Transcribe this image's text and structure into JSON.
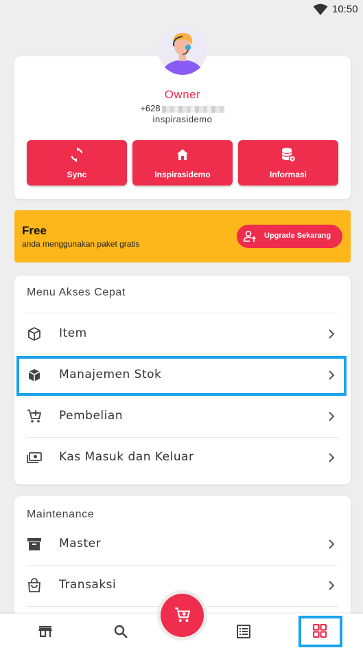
{
  "status_bar": {
    "time": "10:50"
  },
  "profile": {
    "name": "Owner",
    "phone_prefix": "+628",
    "store": "inspirasidemo",
    "actions": [
      {
        "label": "Sync",
        "icon": "sync-icon"
      },
      {
        "label": "Inspirasidemo",
        "icon": "store-icon"
      },
      {
        "label": "Informasi",
        "icon": "database-gear-icon"
      }
    ]
  },
  "plan": {
    "title": "Free",
    "subtitle": "anda menggunakan paket gratis",
    "upgrade_label": "Upgrade Sekarang"
  },
  "quick_menu": {
    "title": "Menu Akses Cepat",
    "items": [
      {
        "label": "Item",
        "icon": "box-icon"
      },
      {
        "label": "Manajemen Stok",
        "icon": "box-settings-icon"
      },
      {
        "label": "Pembelian",
        "icon": "cart-plus-icon"
      },
      {
        "label": "Kas Masuk dan Keluar",
        "icon": "cash-icon"
      }
    ]
  },
  "maintenance": {
    "title": "Maintenance",
    "items": [
      {
        "label": "Master",
        "icon": "archive-icon"
      },
      {
        "label": "Transaksi",
        "icon": "shopping-bag-icon"
      }
    ]
  },
  "bottom_nav": {
    "items": [
      "store-nav-icon",
      "search-icon",
      "cart-fab-icon",
      "list-icon",
      "grid-icon"
    ],
    "active": "grid-icon"
  },
  "colors": {
    "accent": "#ef2d4d",
    "plan_bg": "#fdb71b",
    "highlight": "#1aa3ee"
  }
}
